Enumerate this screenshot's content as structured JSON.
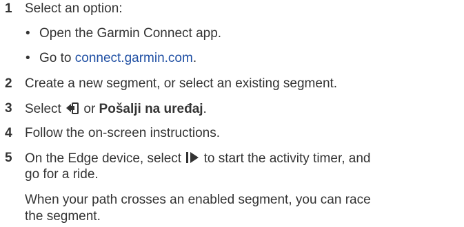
{
  "steps": [
    {
      "number": "1",
      "text": "Select an option:"
    },
    {
      "number": "2",
      "text": "Create a new segment, or select an existing segment."
    },
    {
      "number": "3",
      "prefix": "Select",
      "middle": " or ",
      "bold": "Pošalji na uređaj",
      "suffix": "."
    },
    {
      "number": "4",
      "text": "Follow the on-screen instructions."
    },
    {
      "number": "5",
      "line1_a": "On the Edge device, select",
      "line1_b": "to start the activity timer, and",
      "line2": "go for a ride."
    }
  ],
  "options": [
    {
      "text": "Open the Garmin Connect app."
    },
    {
      "prefix": "Go to ",
      "link": "connect.garmin.com",
      "suffix": "."
    }
  ],
  "note": {
    "line1": "When your path crosses an enabled segment, you can race",
    "line2": "the segment."
  },
  "bullet_char": "•",
  "colors": {
    "text": "#333333",
    "link": "#1f4fa3"
  },
  "icons": {
    "send": "send-to-device-icon",
    "start": "start-timer-icon"
  }
}
